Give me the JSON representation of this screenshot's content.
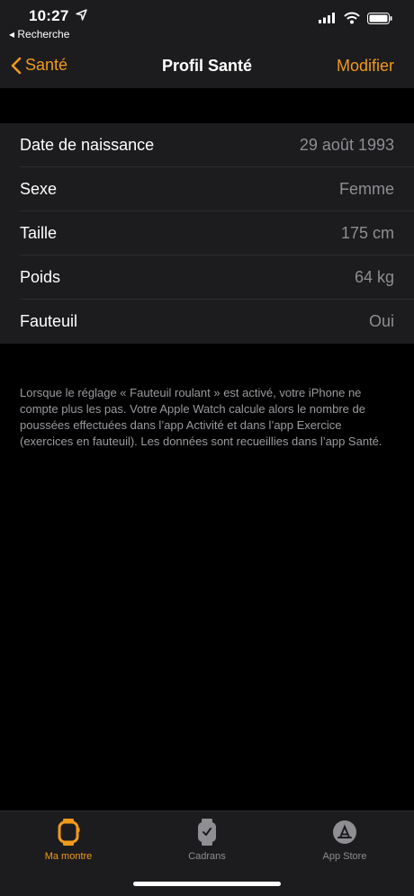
{
  "status": {
    "time": "10:27",
    "back_app": "◂ Recherche"
  },
  "nav": {
    "back_label": "Santé",
    "title": "Profil Santé",
    "edit_label": "Modifier"
  },
  "profile": {
    "rows": [
      {
        "label": "Date de naissance",
        "value": "29 août 1993"
      },
      {
        "label": "Sexe",
        "value": "Femme"
      },
      {
        "label": "Taille",
        "value": "175 cm"
      },
      {
        "label": "Poids",
        "value": "64 kg"
      },
      {
        "label": "Fauteuil",
        "value": "Oui"
      }
    ],
    "footnote": "Lorsque le réglage « Fauteuil roulant » est activé, votre iPhone ne compte plus les pas. Votre Apple Watch calcule alors le nombre de poussées effectuées dans l’app Activité et dans l’app Exercice (exercices en fauteuil). Les données sont recueillies dans l’app Santé."
  },
  "tabs": [
    {
      "label": "Ma montre",
      "icon": "watch-icon",
      "active": true
    },
    {
      "label": "Cadrans",
      "icon": "watch-faces-icon",
      "active": false
    },
    {
      "label": "App Store",
      "icon": "app-store-icon",
      "active": false
    }
  ],
  "colors": {
    "accent": "#f19a1a",
    "background": "#000000",
    "cell": "#1c1c1e",
    "secondary_text": "#8e8e93"
  }
}
